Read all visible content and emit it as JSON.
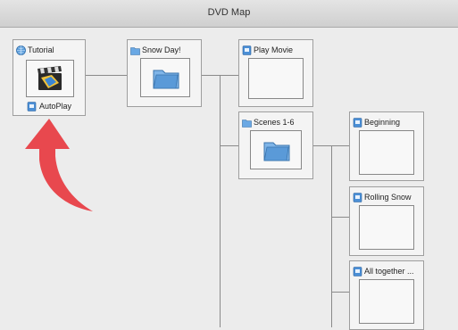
{
  "window": {
    "title": "DVD Map"
  },
  "nodes": {
    "tutorial": {
      "label": "Tutorial",
      "footer": "AutoPlay"
    },
    "snow_day": {
      "label": "Snow Day!"
    },
    "play_movie": {
      "label": "Play Movie"
    },
    "scenes": {
      "label": "Scenes 1-6"
    },
    "beginning": {
      "label": "Beginning"
    },
    "rolling_snow": {
      "label": "Rolling Snow"
    },
    "all_together": {
      "label": "All together ..."
    }
  },
  "colors": {
    "arrow": "#e8484e",
    "folder": "#5a9ad8",
    "movie_icon": "#2f78c4"
  }
}
